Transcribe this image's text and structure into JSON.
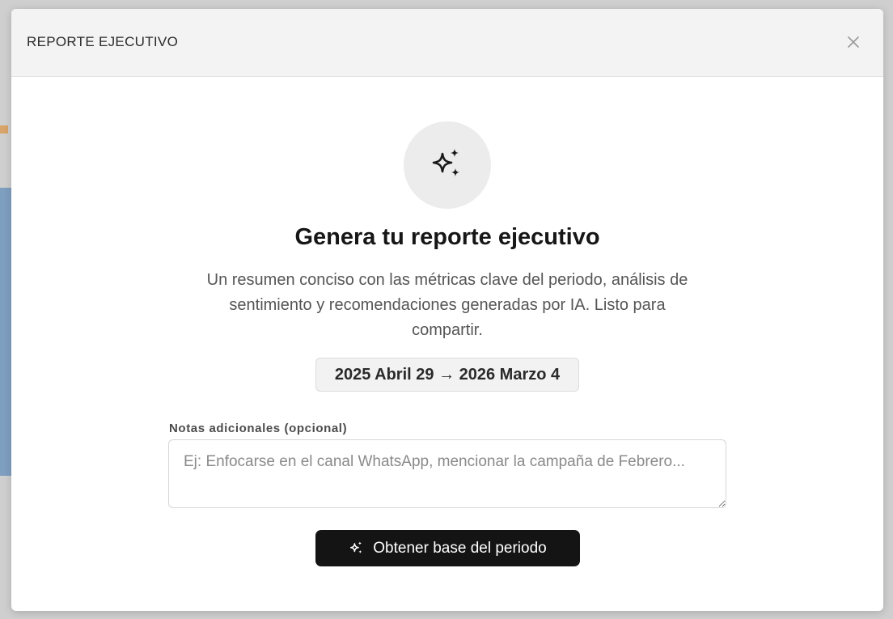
{
  "modal": {
    "title": "REPORTE EJECUTIVO",
    "close_icon": "close-icon"
  },
  "hero": {
    "icon": "sparkles-icon",
    "heading": "Genera tu reporte ejecutivo",
    "description": "Un resumen conciso con las métricas clave del periodo, análisis de sentimiento y recomendaciones generadas por IA. Listo para compartir."
  },
  "period": {
    "range": "2025 Abril 29 → 2026 Marzo 4"
  },
  "notes": {
    "label": "Notas adicionales (opcional)",
    "value": "",
    "placeholder": "Ej: Enfocarse en el canal WhatsApp, mencionar la campaña de Febrero..."
  },
  "action": {
    "icon": "sparkles-icon",
    "label": "Obtener base del periodo"
  },
  "colors": {
    "primary_button_bg": "#141414",
    "header_bg": "#f3f3f3",
    "icon_circle_bg": "#ececec"
  }
}
